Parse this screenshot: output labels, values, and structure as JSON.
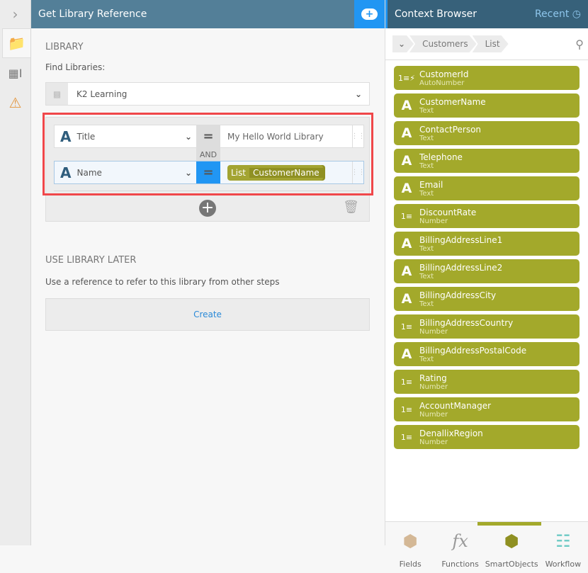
{
  "left_panel": {
    "title": "Get Library Reference",
    "library_heading": "LIBRARY",
    "find_label": "Find Libraries:",
    "library_value": "K2 Learning",
    "filters": [
      {
        "field": "Title",
        "operator": "=",
        "value": "My Hello World Library"
      },
      {
        "field": "Name",
        "operator": "=",
        "chip_prefix": "List",
        "chip_value": "CustomerName"
      }
    ],
    "join": "AND",
    "later_heading": "USE LIBRARY LATER",
    "later_desc": "Use a reference to refer to this library from other steps",
    "create_label": "Create"
  },
  "context_browser": {
    "title": "Context Browser",
    "recent_label": "Recent",
    "breadcrumbs": [
      "Customers",
      "List"
    ],
    "items": [
      {
        "name": "CustomerId",
        "type": "AutoNumber",
        "icon": "autonumber"
      },
      {
        "name": "CustomerName",
        "type": "Text",
        "icon": "text"
      },
      {
        "name": "ContactPerson",
        "type": "Text",
        "icon": "text"
      },
      {
        "name": "Telephone",
        "type": "Text",
        "icon": "text"
      },
      {
        "name": "Email",
        "type": "Text",
        "icon": "text"
      },
      {
        "name": "DiscountRate",
        "type": "Number",
        "icon": "number"
      },
      {
        "name": "BillingAddressLine1",
        "type": "Text",
        "icon": "text"
      },
      {
        "name": "BillingAddressLine2",
        "type": "Text",
        "icon": "text"
      },
      {
        "name": "BillingAddressCity",
        "type": "Text",
        "icon": "text"
      },
      {
        "name": "BillingAddressCountry",
        "type": "Number",
        "icon": "number"
      },
      {
        "name": "BillingAddressPostalCode",
        "type": "Text",
        "icon": "text"
      },
      {
        "name": "Rating",
        "type": "Number",
        "icon": "number"
      },
      {
        "name": "AccountManager",
        "type": "Number",
        "icon": "number"
      },
      {
        "name": "DenallixRegion",
        "type": "Number",
        "icon": "number"
      }
    ],
    "tabs": [
      {
        "label": "Fields"
      },
      {
        "label": "Functions"
      },
      {
        "label": "SmartObjects",
        "active": true
      },
      {
        "label": "Workflow"
      }
    ]
  },
  "colors": {
    "header": "#537f98",
    "accent": "#2196f3",
    "smartobject": "#a3a92b",
    "highlight": "#f0474a"
  }
}
